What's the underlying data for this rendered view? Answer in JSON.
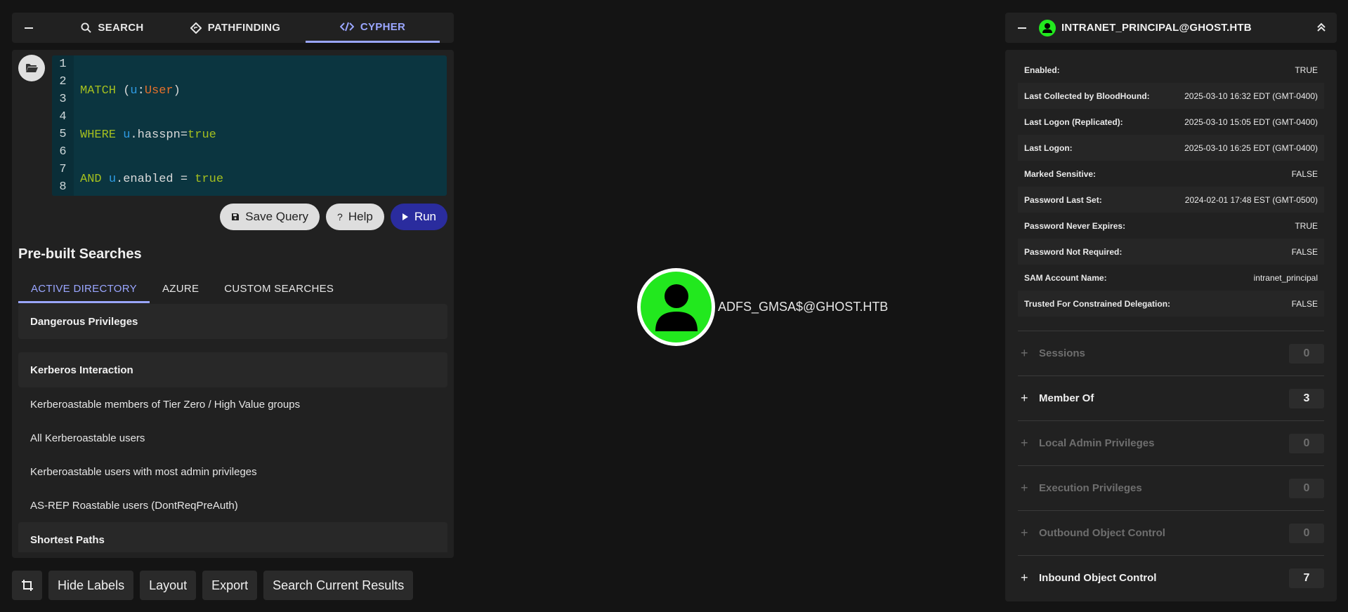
{
  "tabs": [
    {
      "label": "SEARCH",
      "icon": "search-icon"
    },
    {
      "label": "PATHFINDING",
      "icon": "pathfinding-icon"
    },
    {
      "label": "CYPHER",
      "icon": "code-icon"
    }
  ],
  "editor": {
    "line_numbers": [
      "1",
      "2",
      "3",
      "4",
      "5",
      "6",
      "7",
      "8"
    ]
  },
  "buttons": {
    "save_query": "Save Query",
    "help": "Help",
    "run": "Run"
  },
  "prebuilt": {
    "title": "Pre-built Searches",
    "tabs": [
      "ACTIVE DIRECTORY",
      "AZURE",
      "CUSTOM SEARCHES"
    ],
    "cat_dangerous": "Dangerous Privileges",
    "cat_kerberos": "Kerberos Interaction",
    "items": [
      "Kerberoastable members of Tier Zero / High Value groups",
      "All Kerberoastable users",
      "Kerberoastable users with most admin privileges",
      "AS-REP Roastable users (DontReqPreAuth)"
    ],
    "cat_shortest": "Shortest Paths"
  },
  "bottom": {
    "hide_labels": "Hide Labels",
    "layout": "Layout",
    "export": "Export",
    "search_current": "Search Current Results"
  },
  "graph": {
    "node_label": "ADFS_GMSA$@GHOST.HTB",
    "node_color": "#22e81e"
  },
  "details": {
    "title": "INTRANET_PRINCIPAL@GHOST.HTB",
    "properties": [
      {
        "k": "Enabled:",
        "v": "TRUE"
      },
      {
        "k": "Last Collected by BloodHound:",
        "v": "2025-03-10 16:32 EDT (GMT-0400)"
      },
      {
        "k": "Last Logon (Replicated):",
        "v": "2025-03-10 15:05 EDT (GMT-0400)"
      },
      {
        "k": "Last Logon:",
        "v": "2025-03-10 16:25 EDT (GMT-0400)"
      },
      {
        "k": "Marked Sensitive:",
        "v": "FALSE"
      },
      {
        "k": "Password Last Set:",
        "v": "2024-02-01 17:48 EST (GMT-0500)"
      },
      {
        "k": "Password Never Expires:",
        "v": "TRUE"
      },
      {
        "k": "Password Not Required:",
        "v": "FALSE"
      },
      {
        "k": "SAM Account Name:",
        "v": "intranet_principal"
      },
      {
        "k": "Trusted For Constrained Delegation:",
        "v": "FALSE"
      }
    ],
    "sections": [
      {
        "name": "Sessions",
        "count": "0"
      },
      {
        "name": "Member Of",
        "count": "3"
      },
      {
        "name": "Local Admin Privileges",
        "count": "0"
      },
      {
        "name": "Execution Privileges",
        "count": "0"
      },
      {
        "name": "Outbound Object Control",
        "count": "0"
      },
      {
        "name": "Inbound Object Control",
        "count": "7"
      }
    ]
  }
}
